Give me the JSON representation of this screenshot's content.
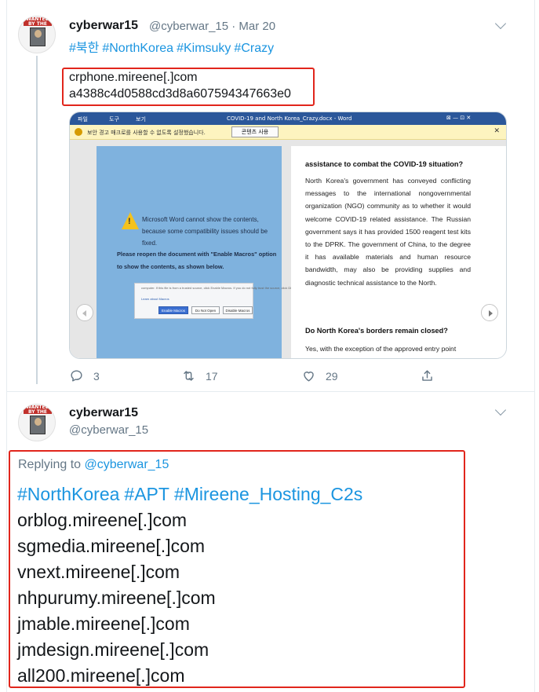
{
  "colors": {
    "link": "#1b95e0",
    "highlight_box": "#e1261c",
    "word_blue": "#2b579a"
  },
  "tweet1": {
    "display_name": "cyberwar15",
    "handle_date": "@cyberwar_15 · Mar 20",
    "hashtags": [
      "#북한",
      "#NorthKorea",
      "#Kimsuky",
      "#Crazy"
    ],
    "ioc_lines": [
      "crphone.mireene[.]com",
      "a4388c4d0588cd3d8a607594347663e0"
    ],
    "media": {
      "ribbon_tabs": [
        "파일",
        "도구",
        "보기"
      ],
      "doc_title": "COVID-19 and North Korea_Crazy.docx - Word",
      "window_controls": "⊠  —  ⊡  ✕",
      "warning_text": "보안 경고  매크로를 사용할 수 없도록 설정했습니다.",
      "enable_content_label": "콘텐츠 사용",
      "lure_message": "Microsoft Word cannot show the contents, because some compatibility issues should be fixed.",
      "lure_instruction": "Please reopen the document with \"Enable Macros\" option to show the contents, as shown below.",
      "dialog_text": "computer. If this file is from a trusted source, click Enable Macros. If you do not fully trust the source, click Disable Macros.",
      "dialog_link": "Learn about Macros",
      "dialog_buttons": [
        "Enable Macros",
        "Do Not Open",
        "Disable Macros"
      ],
      "doc_heading1": "assistance to combat the COVID-19 situation?",
      "doc_para1": "North Korea's government has conveyed conflicting messages to the international nongovernmental organization (NGO) community as to whether it would welcome COVID-19 related assistance. The Russian government says it has provided 1500 reagent test kits to the DPRK. The government of China, to the degree it has available materials and human resource bandwidth, may also be providing supplies and diagnostic technical assistance to the North.",
      "doc_heading2": "Do North Korea's borders remain closed?",
      "doc_para2": "Yes, with the exception of the approved entry point"
    },
    "actions": {
      "replies": "3",
      "retweets": "17",
      "likes": "29"
    }
  },
  "tweet2": {
    "display_name": "cyberwar15",
    "handle": "@cyberwar_15",
    "replying_prefix": "Replying to",
    "replying_to": "@cyberwar_15",
    "hashtags": [
      "#NorthKorea",
      "#APT",
      "#Mireene_Hosting_C2s"
    ],
    "domains": [
      "orblog.mireene[.]com",
      "sgmedia.mireene[.]com",
      "vnext.mireene[.]com",
      "nhpurumy.mireene[.]com",
      "jmable.mireene[.]com",
      "jmdesign.mireene[.]com",
      "all200.mireene[.]com"
    ]
  },
  "avatar_badge": "WANTED BY THE FBI"
}
